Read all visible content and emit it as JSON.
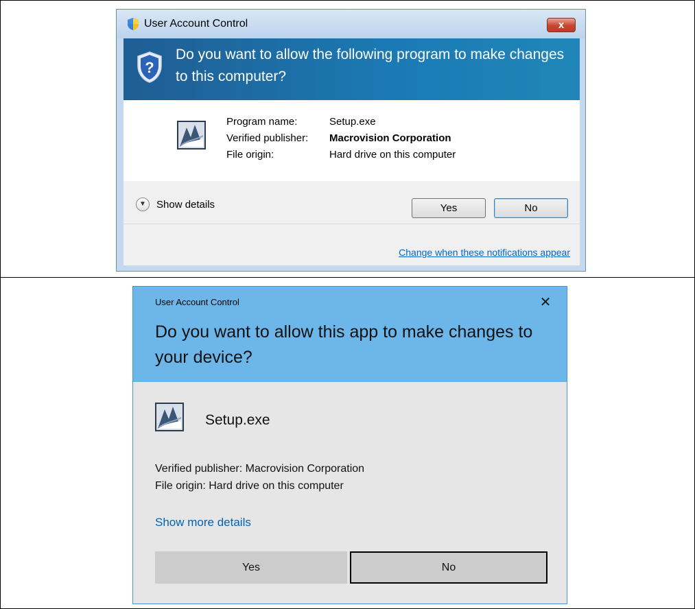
{
  "win7_dialog": {
    "title": "User Account Control",
    "close_label": "x",
    "heading": "Do you want to allow the following program to make changes to this computer?",
    "program_name_label": "Program name:",
    "program_name_value": "Setup.exe",
    "publisher_label": "Verified publisher:",
    "publisher_value": "Macrovision Corporation",
    "origin_label": "File origin:",
    "origin_value": "Hard drive on this computer",
    "show_details": "Show details",
    "yes_label": "Yes",
    "no_label": "No",
    "change_link": "Change when these notifications appear",
    "icons": [
      "uac-shield-icon",
      "shield-question-icon",
      "program-icon",
      "chevron-down-icon"
    ]
  },
  "win10_dialog": {
    "title": "User Account Control",
    "close_label": "✕",
    "heading": "Do you want to allow this app to make changes to your device?",
    "app_name": "Setup.exe",
    "publisher_line": "Verified publisher: Macrovision Corporation",
    "origin_line": "File origin: Hard drive on this computer",
    "show_more": "Show more details",
    "yes_label": "Yes",
    "no_label": "No",
    "icons": [
      "program-icon",
      "close-icon"
    ]
  },
  "colors": {
    "win7_header": "#1b7ab4",
    "win10_header": "#6cb6ea",
    "link_blue": "#0063b1",
    "close_red": "#c8452f"
  }
}
